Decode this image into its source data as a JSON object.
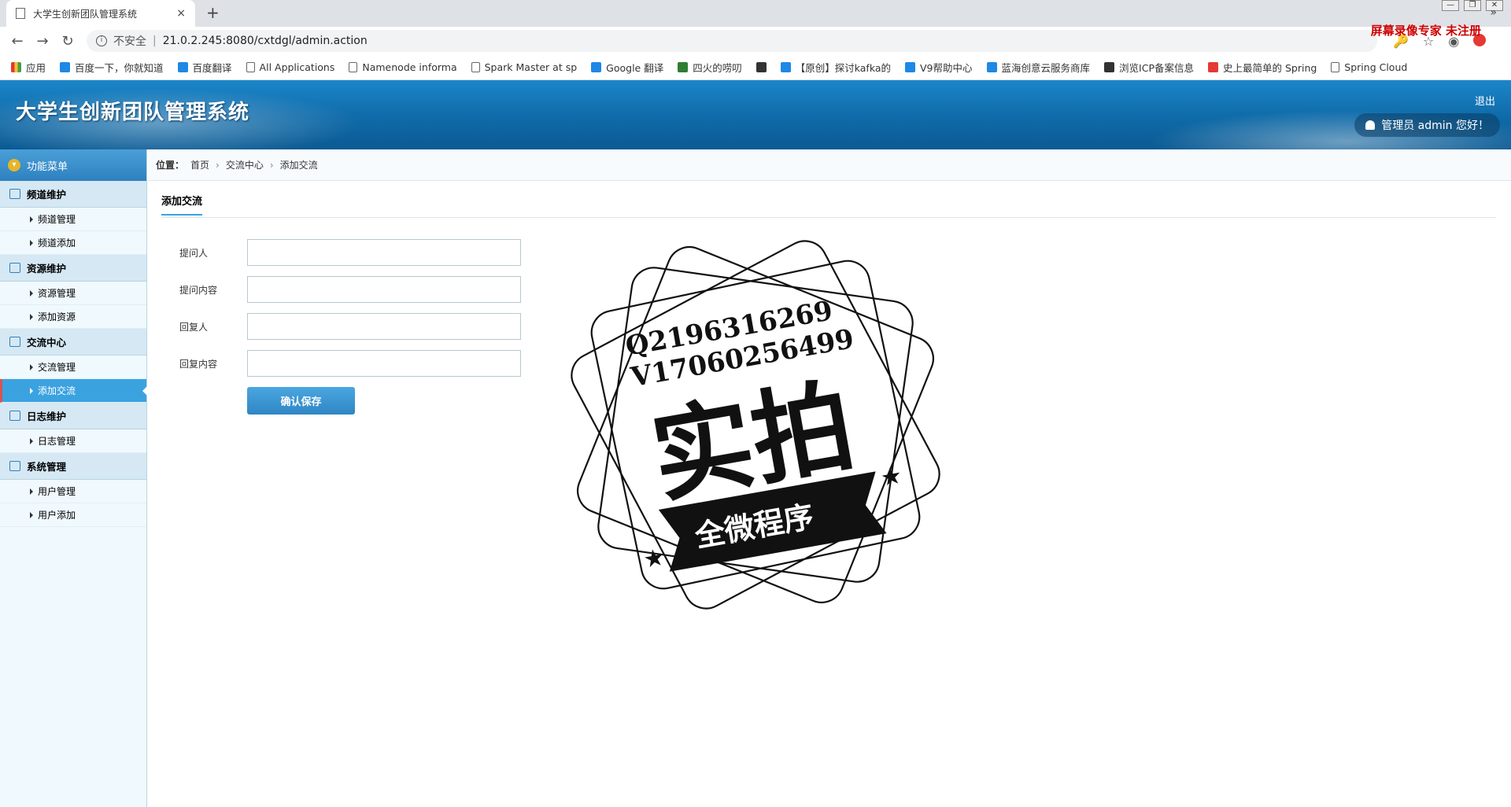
{
  "browser": {
    "tab_title": "大学生创新团队管理系统",
    "tab_close": "×",
    "new_tab": "+",
    "window_controls": [
      "—",
      "❐",
      "✕"
    ],
    "nav": {
      "back": "←",
      "forward": "→",
      "reload": "↻"
    },
    "info_glyph": "i",
    "insecure_label": "不安全",
    "separator": "|",
    "url": "21.0.2.245:8080/cxtdgl/admin.action",
    "right_icons": [
      "🔑",
      "☆",
      "◉"
    ],
    "recorder_watermark": "屏幕录像专家 未注册",
    "more_glyph": "»",
    "bookmarks": [
      {
        "label": "应用",
        "icon": "grid"
      },
      {
        "label": "百度一下，你就知道",
        "icon": "blue"
      },
      {
        "label": "百度翻译",
        "icon": "blue"
      },
      {
        "label": "All Applications",
        "icon": "doc"
      },
      {
        "label": "Namenode informa",
        "icon": "doc"
      },
      {
        "label": "Spark Master at sp",
        "icon": "doc"
      },
      {
        "label": "Google 翻译",
        "icon": "blue"
      },
      {
        "label": "四火的唠叨",
        "icon": "green"
      },
      {
        "label": "",
        "icon": "dark"
      },
      {
        "label": "【原创】探讨kafka的",
        "icon": "blue"
      },
      {
        "label": "V9帮助中心",
        "icon": "blue"
      },
      {
        "label": "蓝海创意云服务商库",
        "icon": "blue"
      },
      {
        "label": "浏览ICP备案信息",
        "icon": "dark"
      },
      {
        "label": "史上最简单的 Spring",
        "icon": "red"
      },
      {
        "label": "Spring Cloud",
        "icon": "doc"
      }
    ]
  },
  "header": {
    "title": "大学生创新团队管理系统",
    "logout": "退出",
    "user_greeting": "管理员 admin 您好！"
  },
  "sidebar": {
    "menu_title": "功能菜单",
    "menu_glyph": "▾",
    "groups": [
      {
        "title": "频道维护",
        "items": [
          "频道管理",
          "频道添加"
        ]
      },
      {
        "title": "资源维护",
        "items": [
          "资源管理",
          "添加资源"
        ]
      },
      {
        "title": "交流中心",
        "items": [
          "交流管理",
          "添加交流"
        ]
      },
      {
        "title": "日志维护",
        "items": [
          "日志管理"
        ]
      },
      {
        "title": "系统管理",
        "items": [
          "用户管理",
          "用户添加"
        ]
      }
    ]
  },
  "breadcrumb": {
    "label": "位置：",
    "arrow": "›",
    "items": [
      "首页",
      "交流中心",
      "添加交流"
    ]
  },
  "form": {
    "section_title": "添加交流",
    "fields": [
      {
        "label": "提问人",
        "value": ""
      },
      {
        "label": "提问内容",
        "value": ""
      },
      {
        "label": "回复人",
        "value": ""
      },
      {
        "label": "回复内容",
        "value": ""
      }
    ],
    "submit_label": "确认保存"
  },
  "stamp": {
    "line1": "Q2196316269",
    "line2": "V17060256499",
    "big_text": "实拍",
    "ribbon_text": "全微程序"
  }
}
